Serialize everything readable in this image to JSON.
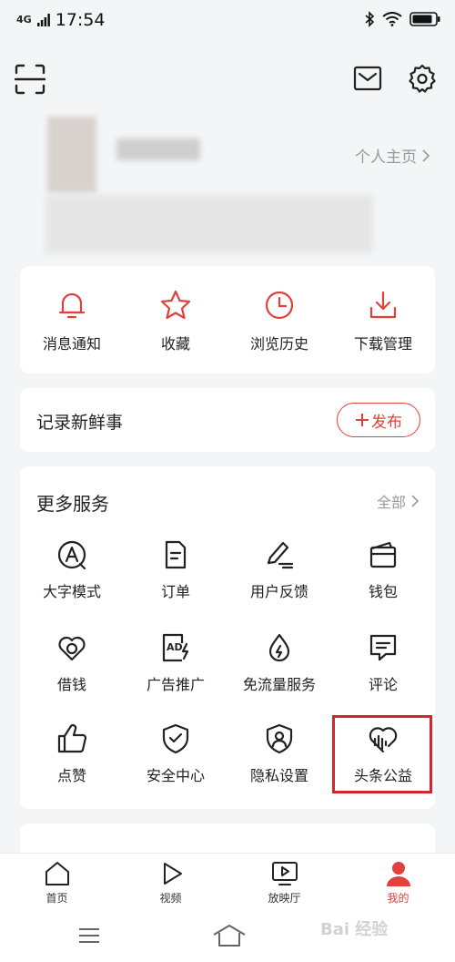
{
  "status_bar": {
    "network": "4G",
    "time": "17:54"
  },
  "profile": {
    "homepage_link": "个人主页"
  },
  "quick_actions": [
    {
      "label": "消息通知",
      "icon": "bell-icon"
    },
    {
      "label": "收藏",
      "icon": "star-icon"
    },
    {
      "label": "浏览历史",
      "icon": "clock-icon"
    },
    {
      "label": "下载管理",
      "icon": "download-icon"
    }
  ],
  "record": {
    "title": "记录新鲜事",
    "publish_label": "发布"
  },
  "services": {
    "title": "更多服务",
    "all_label": "全部",
    "items": [
      {
        "label": "大字模式",
        "icon": "large-font-icon"
      },
      {
        "label": "订单",
        "icon": "order-icon"
      },
      {
        "label": "用户反馈",
        "icon": "feedback-icon"
      },
      {
        "label": "钱包",
        "icon": "wallet-icon"
      },
      {
        "label": "借钱",
        "icon": "borrow-icon"
      },
      {
        "label": "广告推广",
        "icon": "ad-icon"
      },
      {
        "label": "免流量服务",
        "icon": "data-free-icon"
      },
      {
        "label": "评论",
        "icon": "comment-icon"
      },
      {
        "label": "点赞",
        "icon": "thumbs-up-icon"
      },
      {
        "label": "安全中心",
        "icon": "shield-icon"
      },
      {
        "label": "隐私设置",
        "icon": "privacy-icon"
      },
      {
        "label": "头条公益",
        "icon": "charity-icon"
      }
    ]
  },
  "tabs": [
    {
      "label": "首页",
      "icon": "home-icon"
    },
    {
      "label": "视频",
      "icon": "play-icon"
    },
    {
      "label": "放映厅",
      "icon": "screen-icon"
    },
    {
      "label": "我的",
      "icon": "person-icon",
      "active": true
    }
  ],
  "watermark": "Bai 经验",
  "colors": {
    "accent": "#e0413b",
    "highlight_box": "#d0262d",
    "background": "#f4f5f6"
  }
}
